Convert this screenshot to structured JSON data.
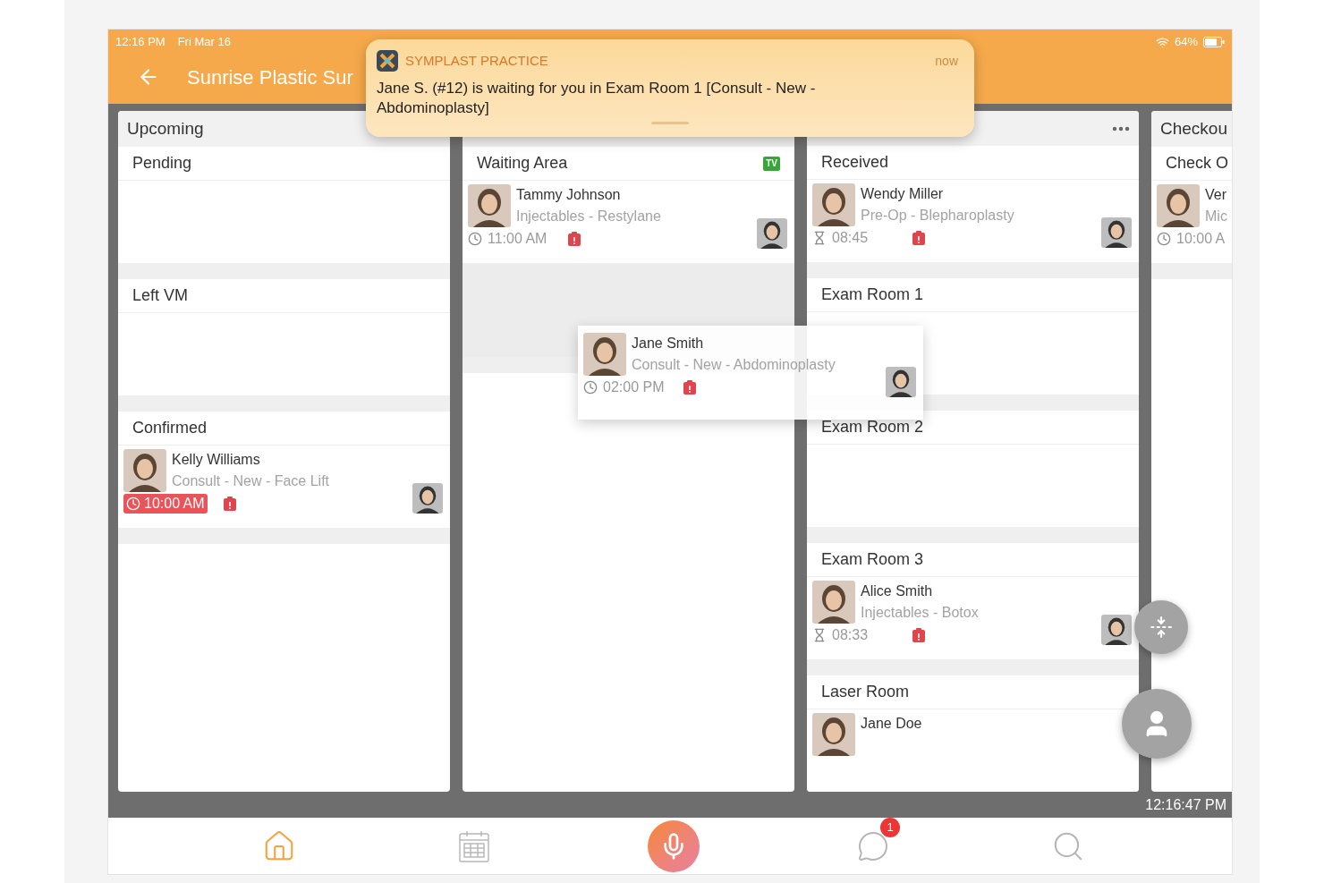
{
  "status_bar": {
    "time": "12:16 PM",
    "date": "Fri Mar 16",
    "battery": "64%"
  },
  "header": {
    "title": "Sunrise Plastic Sur"
  },
  "notification": {
    "app": "SYMPLAST PRACTICE",
    "time": "now",
    "body": "Jane S. (#12) is waiting for you in Exam Room 1 [Consult - New - Abdominoplasty]"
  },
  "columns": [
    {
      "title": "Upcoming",
      "menu": false,
      "sections": [
        {
          "title": "Pending"
        },
        {
          "title": "Left VM"
        },
        {
          "title": "Confirmed",
          "cards": [
            {
              "name": "Kelly Williams",
              "subtitle": "Consult - New - Face Lift",
              "time": "10:00 AM",
              "kind": "clock",
              "overdue": true,
              "provider_avatar": true
            }
          ]
        }
      ]
    },
    {
      "menu": false,
      "sections": [
        {
          "title": "Waiting Area",
          "badge": "TV",
          "drop_placeholder": true,
          "cards": [
            {
              "name": "Tammy Johnson",
              "subtitle": "Injectables - Restylane",
              "time": "11:00 AM",
              "kind": "clock",
              "overdue": false,
              "provider_avatar": true
            }
          ]
        }
      ]
    },
    {
      "menu": true,
      "sections": [
        {
          "title": "Received",
          "cards": [
            {
              "name": "Wendy Miller",
              "subtitle": "Pre-Op - Blepharoplasty",
              "time": "08:45",
              "kind": "timer",
              "overdue": false,
              "provider_avatar": true
            }
          ]
        },
        {
          "title": "Exam Room 1"
        },
        {
          "title": "Exam Room 2"
        },
        {
          "title": "Exam Room 3",
          "cards": [
            {
              "name": "Alice Smith",
              "subtitle": "Injectables - Botox",
              "time": "08:33",
              "kind": "timer",
              "overdue": false,
              "provider_avatar": true
            }
          ]
        },
        {
          "title": "Laser Room",
          "cards": [
            {
              "name": "Jane Doe"
            }
          ]
        }
      ]
    },
    {
      "title": "Checkou",
      "sections": [
        {
          "title": "Check O",
          "cards": [
            {
              "name": "Ver",
              "subtitle": "Mic",
              "time": "10:00 A",
              "kind": "clock",
              "overdue": false,
              "provider_avatar": false
            }
          ]
        }
      ]
    }
  ],
  "dragged_card": {
    "name": "Jane Smith",
    "subtitle": "Consult - New - Abdominoplasty",
    "time": "02:00 PM",
    "kind": "clock",
    "overdue": false,
    "provider_avatar": true
  },
  "clock": "12:16:47 PM",
  "tabs": [
    {
      "kind": "home",
      "selected": true
    },
    {
      "kind": "calendar",
      "selected": false
    },
    {
      "kind": "mic",
      "selected": false
    },
    {
      "kind": "chat",
      "selected": false,
      "badge": "1"
    },
    {
      "kind": "search",
      "selected": false
    }
  ]
}
